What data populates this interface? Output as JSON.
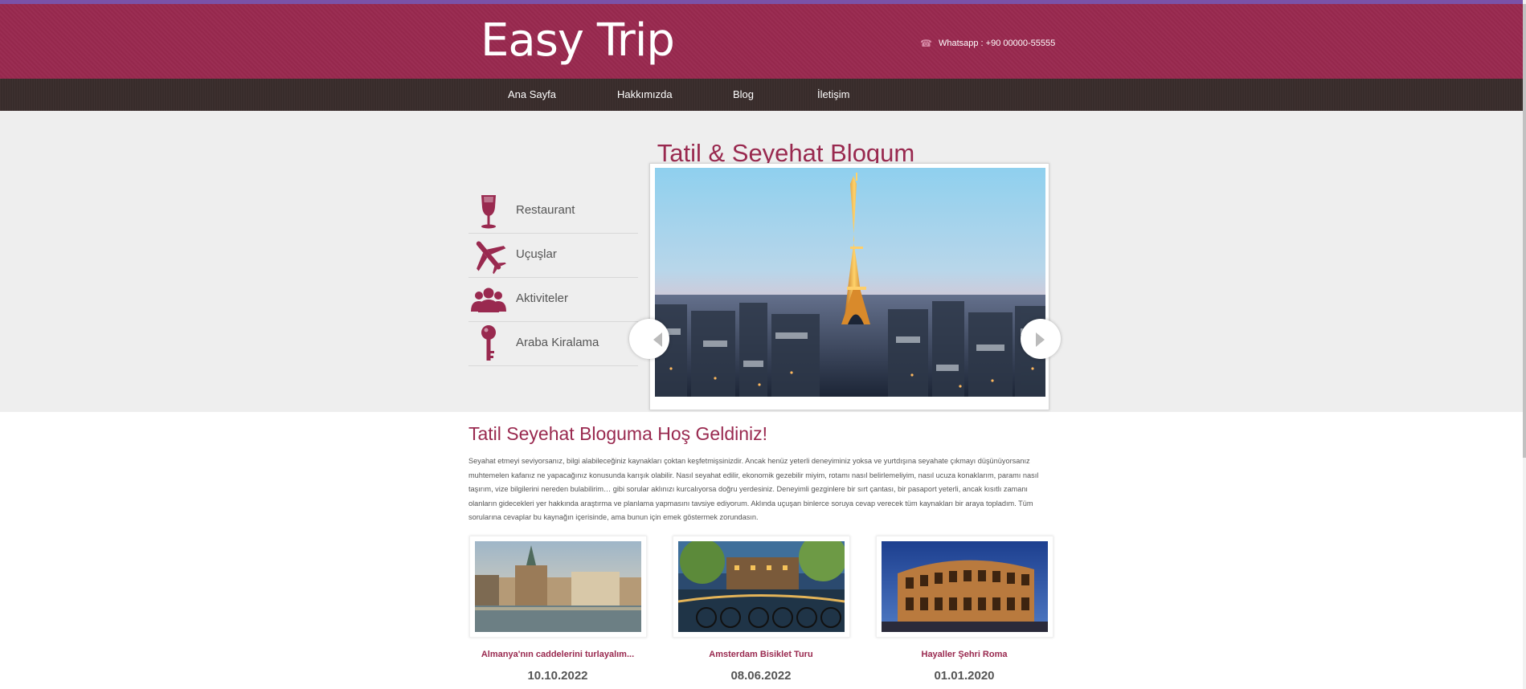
{
  "site": {
    "logo": "Easy Trip",
    "contact": "Whatsapp : +90 00000-55555",
    "phone_icon": "☎"
  },
  "nav": [
    "Ana Sayfa",
    "Hakkımızda",
    "Blog",
    "İletişim"
  ],
  "hero": {
    "title": "Tatil & Seyehat Blogum",
    "menu": [
      {
        "label": "Restaurant",
        "icon": "wine-glass-icon"
      },
      {
        "label": "Uçuşlar",
        "icon": "airplane-icon"
      },
      {
        "label": "Aktiviteler",
        "icon": "people-icon"
      },
      {
        "label": "Araba Kiralama",
        "icon": "key-icon"
      }
    ],
    "slide_image": "eiffel-tower-paris"
  },
  "welcome": {
    "heading": "Tatil Seyehat Bloguma Hoş Geldiniz!",
    "text": "Seyahat etmeyi seviyorsanız, bilgi alabileceğiniz kaynakları çoktan keşfetmişsinizdir. Ancak henüz yeterli deneyiminiz yoksa ve yurtdışına seyahate çıkmayı düşünüyorsanız muhtemelen kafanız ne yapacağınız konusunda karışık olabilir. Nasıl seyahat edilir, ekonomik gezebilir miyim, rotamı nasıl belirlemeliyim, nasıl ucuza konaklarım, paramı nasıl taşırım, vize bilgilerini nereden bulabilirim… gibi sorular aklınızı kurcalıyorsa doğru yerdesiniz. Deneyimli gezginlere bir sırt çantası, bir pasaport yeterli, ancak kısıtlı zamanı olanların gidecekleri yer hakkında araştırma ve planlama yapmasını tavsiye ediyorum. Aklında uçuşan binlerce soruya cevap verecek tüm kaynakları bir araya topladım. Tüm sorularına cevaplar bu kaynağın içerisinde, ama bunun için emek göstermek zorundasın."
  },
  "posts": [
    {
      "title": "Almanya'nın caddelerini turlayalım...",
      "date": "10.10.2022",
      "image": "hamburg-city-hall"
    },
    {
      "title": "Amsterdam Bisiklet Turu",
      "date": "08.06.2022",
      "image": "amsterdam-canal-bicycles"
    },
    {
      "title": "Hayaller Şehri Roma",
      "date": "01.01.2020",
      "image": "rome-colosseum"
    }
  ],
  "colors": {
    "primary": "#99294f",
    "nav": "#3a2d2c",
    "hero_bg": "#eeeeee"
  }
}
